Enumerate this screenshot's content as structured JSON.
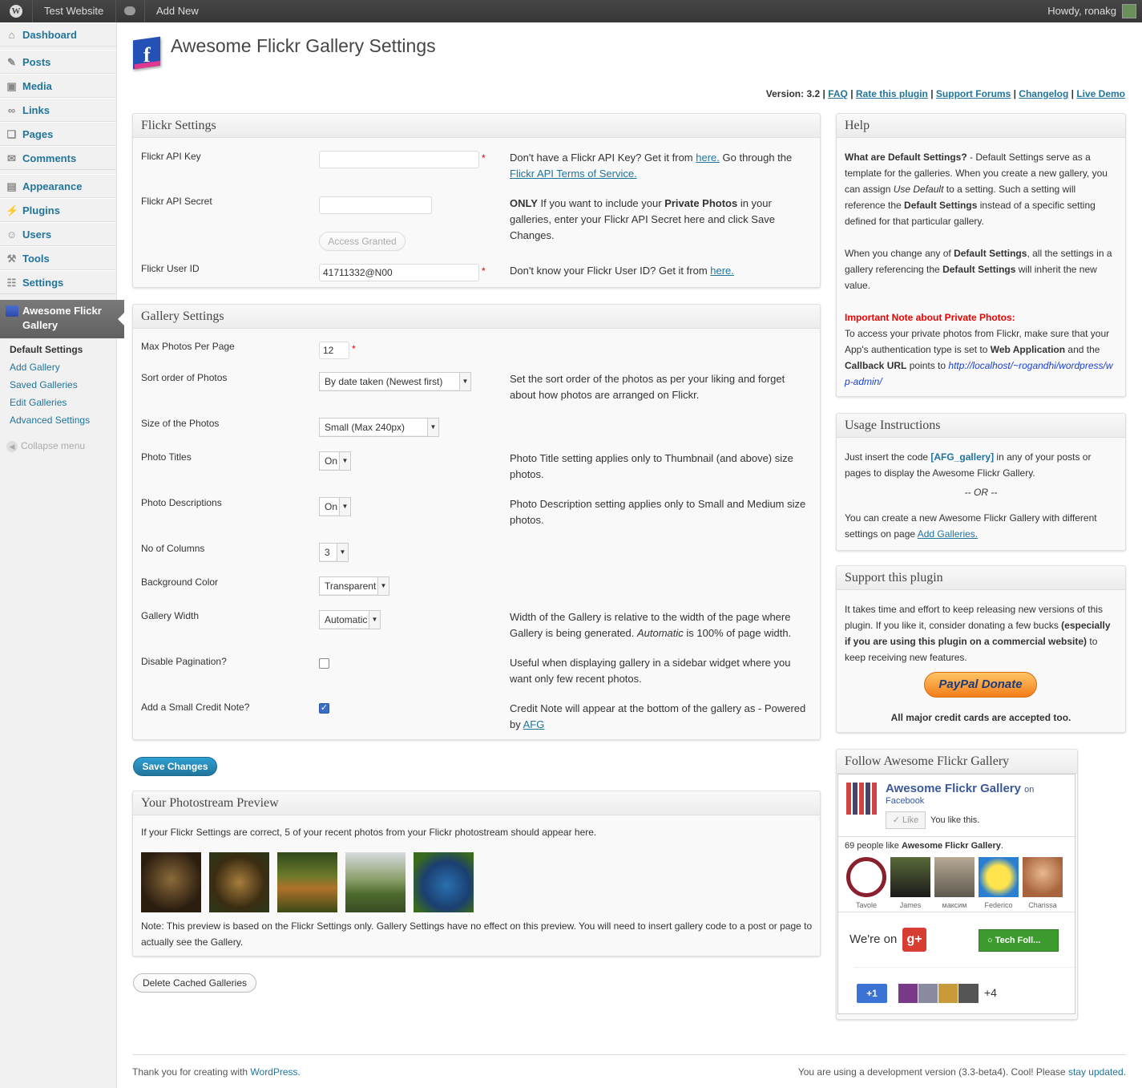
{
  "adminbar": {
    "site": "Test Website",
    "add_new": "Add New",
    "howdy": "Howdy, ronakg"
  },
  "menu": {
    "items": [
      {
        "label": "Dashboard",
        "icon": "dashboard-icon"
      },
      {
        "label": "Posts",
        "icon": "posts-icon"
      },
      {
        "label": "Media",
        "icon": "media-icon"
      },
      {
        "label": "Links",
        "icon": "links-icon"
      },
      {
        "label": "Pages",
        "icon": "pages-icon"
      },
      {
        "label": "Comments",
        "icon": "comments-icon"
      },
      {
        "label": "Appearance",
        "icon": "appearance-icon"
      },
      {
        "label": "Plugins",
        "icon": "plugins-icon"
      },
      {
        "label": "Users",
        "icon": "users-icon"
      },
      {
        "label": "Tools",
        "icon": "tools-icon"
      },
      {
        "label": "Settings",
        "icon": "settings-icon"
      }
    ],
    "current": "Awesome Flickr Gallery",
    "submenu": [
      "Default Settings",
      "Add Gallery",
      "Saved Galleries",
      "Edit Galleries",
      "Advanced Settings"
    ],
    "collapse": "Collapse menu"
  },
  "header": {
    "title": "Awesome Flickr Gallery Settings",
    "version_label": "Version: 3.2",
    "links": [
      "FAQ",
      "Rate this plugin",
      "Support Forums",
      "Changelog",
      "Live Demo"
    ]
  },
  "flickr_settings": {
    "title": "Flickr Settings",
    "api_key_label": "Flickr API Key",
    "api_key_value": "",
    "api_key_help_pre": "Don't have a Flickr API Key? Get it from ",
    "api_key_help_link": "here.",
    "api_key_help_mid": " Go through the ",
    "api_key_help_link2": "Flickr API Terms of Service.",
    "api_secret_label": "Flickr API Secret",
    "api_secret_value": "",
    "access_btn": "Access Granted",
    "secret_help_b1": "ONLY",
    "secret_help_1": " If you want to include your ",
    "secret_help_b2": "Private Photos",
    "secret_help_2": " in your galleries, enter your Flickr API Secret here and click Save Changes.",
    "user_id_label": "Flickr User ID",
    "user_id_value": "41711332@N00",
    "user_id_help": "Don't know your Flickr User ID? Get it from ",
    "user_id_link": "here."
  },
  "gallery_settings": {
    "title": "Gallery Settings",
    "max_photos_label": "Max Photos Per Page",
    "max_photos_value": "12",
    "sort_label": "Sort order of Photos",
    "sort_value": "By date taken (Newest first)",
    "sort_help": "Set the sort order of the photos as per your liking and forget about how photos are arranged on Flickr.",
    "size_label": "Size of the Photos",
    "size_value": "Small (Max 240px)",
    "titles_label": "Photo Titles",
    "titles_value": "On",
    "titles_help": "Photo Title setting applies only to Thumbnail (and above) size photos.",
    "desc_label": "Photo Descriptions",
    "desc_value": "On",
    "desc_help": "Photo Description setting applies only to Small and Medium size photos.",
    "columns_label": "No of Columns",
    "columns_value": "3",
    "bg_label": "Background Color",
    "bg_value": "Transparent",
    "width_label": "Gallery Width",
    "width_value": "Automatic",
    "width_help_1": "Width of the Gallery is relative to the width of the page where Gallery is being generated. ",
    "width_help_em": "Automatic",
    "width_help_2": " is 100% of page width.",
    "pagination_label": "Disable Pagination?",
    "pagination_checked": false,
    "pagination_help": "Useful when displaying gallery in a sidebar widget where you want only few recent photos.",
    "credit_label": "Add a Small Credit Note?",
    "credit_checked": true,
    "credit_help": "Credit Note will appear at the bottom of the gallery as - Powered by ",
    "credit_link": "AFG"
  },
  "save_button": "Save Changes",
  "preview": {
    "title": "Your Photostream Preview",
    "intro": "If your Flickr Settings are correct, 5 of your recent photos from your Flickr photostream should appear here.",
    "note": "Note: This preview is based on the Flickr Settings only. Gallery Settings have no effect on this preview. You will need to insert gallery code to a post or page to actually see the Gallery."
  },
  "delete_button": "Delete Cached Galleries",
  "help": {
    "title": "Help",
    "q1": "What are Default Settings?",
    "p1a": " - Default Settings serve as a template for the galleries. When you create a new gallery, you can assign ",
    "p1em": "Use Default",
    "p1b": " to a setting. Such a setting will reference the ",
    "p1bold": "Default Settings",
    "p1c": " instead of a specific setting defined for that particular gallery.",
    "p2a": "When you change any of ",
    "p2b1": "Default Settings",
    "p2b": ", all the settings in a gallery referencing the ",
    "p2b2": "Default Settings",
    "p2c": " will inherit the new value.",
    "note_title": "Important Note about Private Photos:",
    "note_a": "To access your private photos from Flickr, make sure that your App's authentication type is set to ",
    "note_b1": "Web Application",
    "note_b": " and the ",
    "note_b2": "Callback URL",
    "note_c": " points to ",
    "note_url": "http://localhost/~rogandhi/wordpress/wp-admin/"
  },
  "usage": {
    "title": "Usage Instructions",
    "p1a": "Just insert the code ",
    "code": "[AFG_gallery]",
    "p1b": " in any of your posts or pages to display the Awesome Flickr Gallery.",
    "or": "-- OR --",
    "p2": "You can create a new Awesome Flickr Gallery with different settings on page ",
    "p2link": "Add Galleries."
  },
  "support": {
    "title": "Support this plugin",
    "p1a": "It takes time and effort to keep releasing new versions of this plugin. If you like it, consider donating a few bucks ",
    "p1bold": "(especially if you are using this plugin on a commercial website)",
    "p1b": " to keep receiving new features.",
    "donate": "PayPal Donate",
    "cards": "All major credit cards are accepted too."
  },
  "follow": {
    "title": "Follow Awesome Flickr Gallery",
    "page_name": "Awesome Flickr Gallery",
    "on": "on",
    "facebook": "Facebook",
    "like": "Like",
    "you_like": "You like this.",
    "count_pre": "69 people like ",
    "count_bold": "Awesome Flickr Gallery",
    "count_post": ".",
    "fans": [
      "Tavole",
      "James",
      "максим",
      "Federico",
      "Charissa"
    ],
    "were_on": "We're on",
    "gplus_btn": "Tech Foll...",
    "plus_one": "+1",
    "plus_count": "+4"
  },
  "footer": {
    "left_pre": "Thank you for creating with ",
    "left_link": "WordPress",
    "left_post": ".",
    "right_pre": "You are using a development version (3.3-beta4). Cool! Please ",
    "right_link": "stay updated",
    "right_post": "."
  },
  "colors": {
    "link": "#21759b",
    "admin_bar": "#464646",
    "important": "#ee0000",
    "donate": "#f57d1a"
  }
}
